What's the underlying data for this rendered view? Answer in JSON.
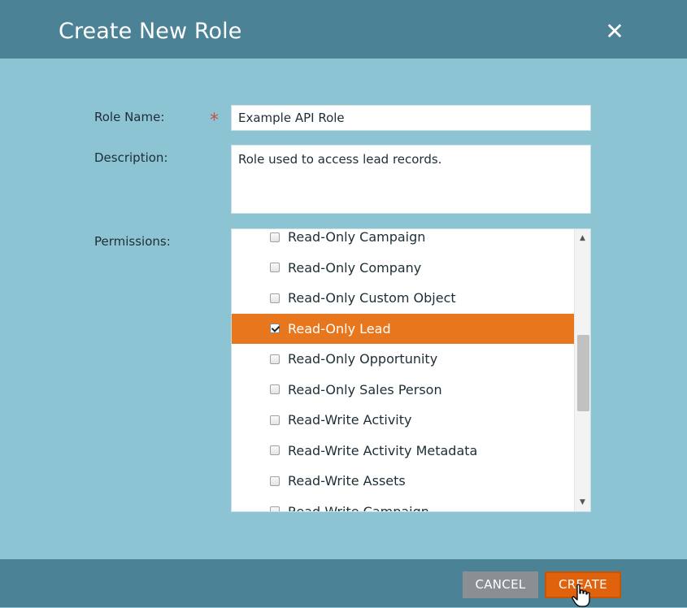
{
  "dialog": {
    "title": "Create New Role",
    "close_icon": "close-icon"
  },
  "form": {
    "role_name_label": "Role Name:",
    "required_marker": "*",
    "role_name_value": "Example API Role",
    "description_label": "Description:",
    "description_value": "Role used to access lead records.",
    "permissions_label": "Permissions:"
  },
  "permissions": [
    {
      "label": "Read-Only Campaign",
      "checked": false
    },
    {
      "label": "Read-Only Company",
      "checked": false
    },
    {
      "label": "Read-Only Custom Object",
      "checked": false
    },
    {
      "label": "Read-Only Lead",
      "checked": true
    },
    {
      "label": "Read-Only Opportunity",
      "checked": false
    },
    {
      "label": "Read-Only Sales Person",
      "checked": false
    },
    {
      "label": "Read-Write Activity",
      "checked": false
    },
    {
      "label": "Read-Write Activity Metadata",
      "checked": false
    },
    {
      "label": "Read-Write Assets",
      "checked": false
    },
    {
      "label": "Read-Write Campaign",
      "checked": false
    }
  ],
  "footer": {
    "cancel_label": "CANCEL",
    "create_label": "CREATE"
  },
  "colors": {
    "header": "#4c8296",
    "body": "#8dc4d3",
    "selected": "#e8761d",
    "primary_button": "#e0620d",
    "secondary_button": "#8a8f93"
  }
}
